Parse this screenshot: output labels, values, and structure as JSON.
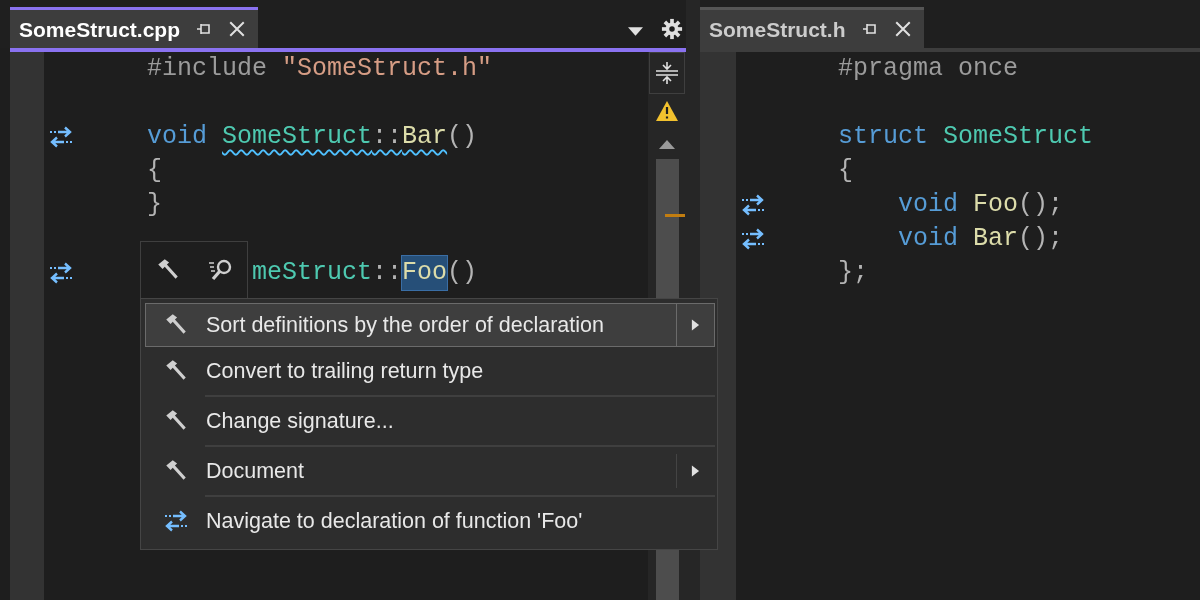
{
  "left_editor": {
    "tab": {
      "title": "SomeStruct.cpp",
      "selected": true
    },
    "lines": [
      {
        "kind": "code",
        "nav": false,
        "covered": false,
        "tokens": [
          {
            "text": "#include",
            "kind": "preproc"
          },
          {
            "text": "\"SomeStruct.h\"",
            "kind": "string"
          }
        ]
      },
      {
        "kind": "blank"
      },
      {
        "kind": "code",
        "nav": true,
        "covered": false,
        "tokens": [
          {
            "text": "void",
            "kind": "keyword",
            "squiggle": false
          },
          {
            "text": "SomeStruct",
            "kind": "type",
            "squiggle": true
          },
          {
            "text": "::",
            "kind": "punct",
            "squiggle": true
          },
          {
            "text": "Bar",
            "kind": "func",
            "squiggle": true
          },
          {
            "text": "()",
            "kind": "punct",
            "squiggle": false
          }
        ]
      },
      {
        "kind": "code",
        "nav": false,
        "covered": false,
        "tokens": [
          {
            "text": "{",
            "kind": "punct"
          }
        ]
      },
      {
        "kind": "code",
        "nav": false,
        "covered": false,
        "tokens": [
          {
            "text": "}",
            "kind": "punct"
          }
        ]
      },
      {
        "kind": "blank"
      },
      {
        "kind": "code",
        "nav": true,
        "covered": true,
        "tokens": [
          {
            "text": "meStruct",
            "kind": "type",
            "highlighted": false
          },
          {
            "text": "::",
            "kind": "punct",
            "highlighted": false
          },
          {
            "text": "Foo",
            "kind": "func",
            "highlighted": true
          },
          {
            "text": "()",
            "kind": "punct",
            "highlighted": false
          }
        ]
      }
    ]
  },
  "right_editor": {
    "tab": {
      "title": "SomeStruct.h",
      "selected": false
    },
    "lines": [
      {
        "kind": "code",
        "nav": false,
        "covered": false,
        "tokens": [
          {
            "text": "#pragma once",
            "kind": "preproc"
          }
        ]
      },
      {
        "kind": "blank"
      },
      {
        "kind": "code",
        "nav": false,
        "covered": false,
        "tokens": [
          {
            "text": "struct",
            "kind": "keyword"
          },
          {
            "text": "SomeStruct",
            "kind": "type"
          }
        ]
      },
      {
        "kind": "code",
        "nav": false,
        "covered": false,
        "tokens": [
          {
            "text": "{",
            "kind": "punct"
          }
        ],
        "children": [
          {
            "kind": "code",
            "nav": true,
            "covered": false,
            "tokens": [
              {
                "text": "void",
                "kind": "keyword"
              },
              {
                "text": "Foo",
                "kind": "func"
              },
              {
                "text": "();",
                "kind": "punct"
              }
            ]
          },
          {
            "kind": "code",
            "nav": true,
            "covered": false,
            "tokens": [
              {
                "text": "void",
                "kind": "keyword"
              },
              {
                "text": "Bar",
                "kind": "func"
              },
              {
                "text": "();",
                "kind": "punct"
              }
            ]
          }
        ]
      },
      {
        "kind": "code",
        "nav": false,
        "covered": false,
        "tokens": [
          {
            "text": "};",
            "kind": "punct"
          }
        ]
      }
    ]
  },
  "quick_actions_menu": {
    "items": [
      {
        "label": "Sort definitions by the order of declaration",
        "kind": "refactor",
        "submenu": true,
        "selected": true
      },
      {
        "label": "Convert to trailing return type",
        "kind": "refactor",
        "submenu": false,
        "selected": false
      },
      {
        "label": "Change signature...",
        "kind": "refactor",
        "submenu": false,
        "selected": false
      },
      {
        "label": "Document",
        "kind": "refactor",
        "submenu": true,
        "selected": false
      },
      {
        "label": "Navigate to declaration of function 'Foo'",
        "kind": "navigate",
        "submenu": false,
        "selected": false
      }
    ]
  }
}
